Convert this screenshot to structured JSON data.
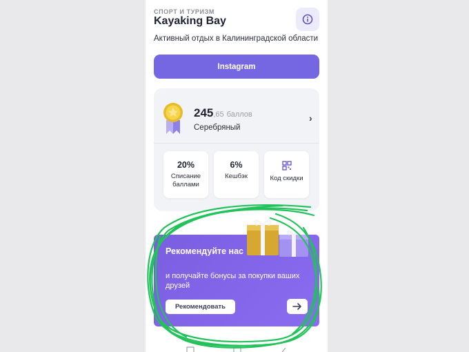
{
  "header": {
    "category": "СПОРТ И ТУРИЗМ",
    "title": "Kayaking Bay",
    "subtitle": "Активный отдых в Калининградской области",
    "info_icon": "info-icon"
  },
  "instagram_button": {
    "label": "Instagram"
  },
  "loyalty": {
    "points_int": "245",
    "points_fraction": ",65",
    "points_unit": "баллов",
    "level": "Серебряный",
    "medal_icon": "medal-icon",
    "tiles": [
      {
        "value": "20%",
        "label": "Списание баллами"
      },
      {
        "value": "6%",
        "label": "Кешбэк"
      },
      {
        "icon": "qr-code-icon",
        "label": "Код скидки"
      }
    ]
  },
  "referral": {
    "title": "Рекомендуйте нас",
    "text": "и получайте бонусы за покупки ваших друзей",
    "button_label": "Рекомендовать",
    "arrow_icon": "arrow-right-icon"
  },
  "colors": {
    "accent": "#7567e2",
    "promo": "#7a5ee0",
    "annotation": "#22c25a"
  }
}
